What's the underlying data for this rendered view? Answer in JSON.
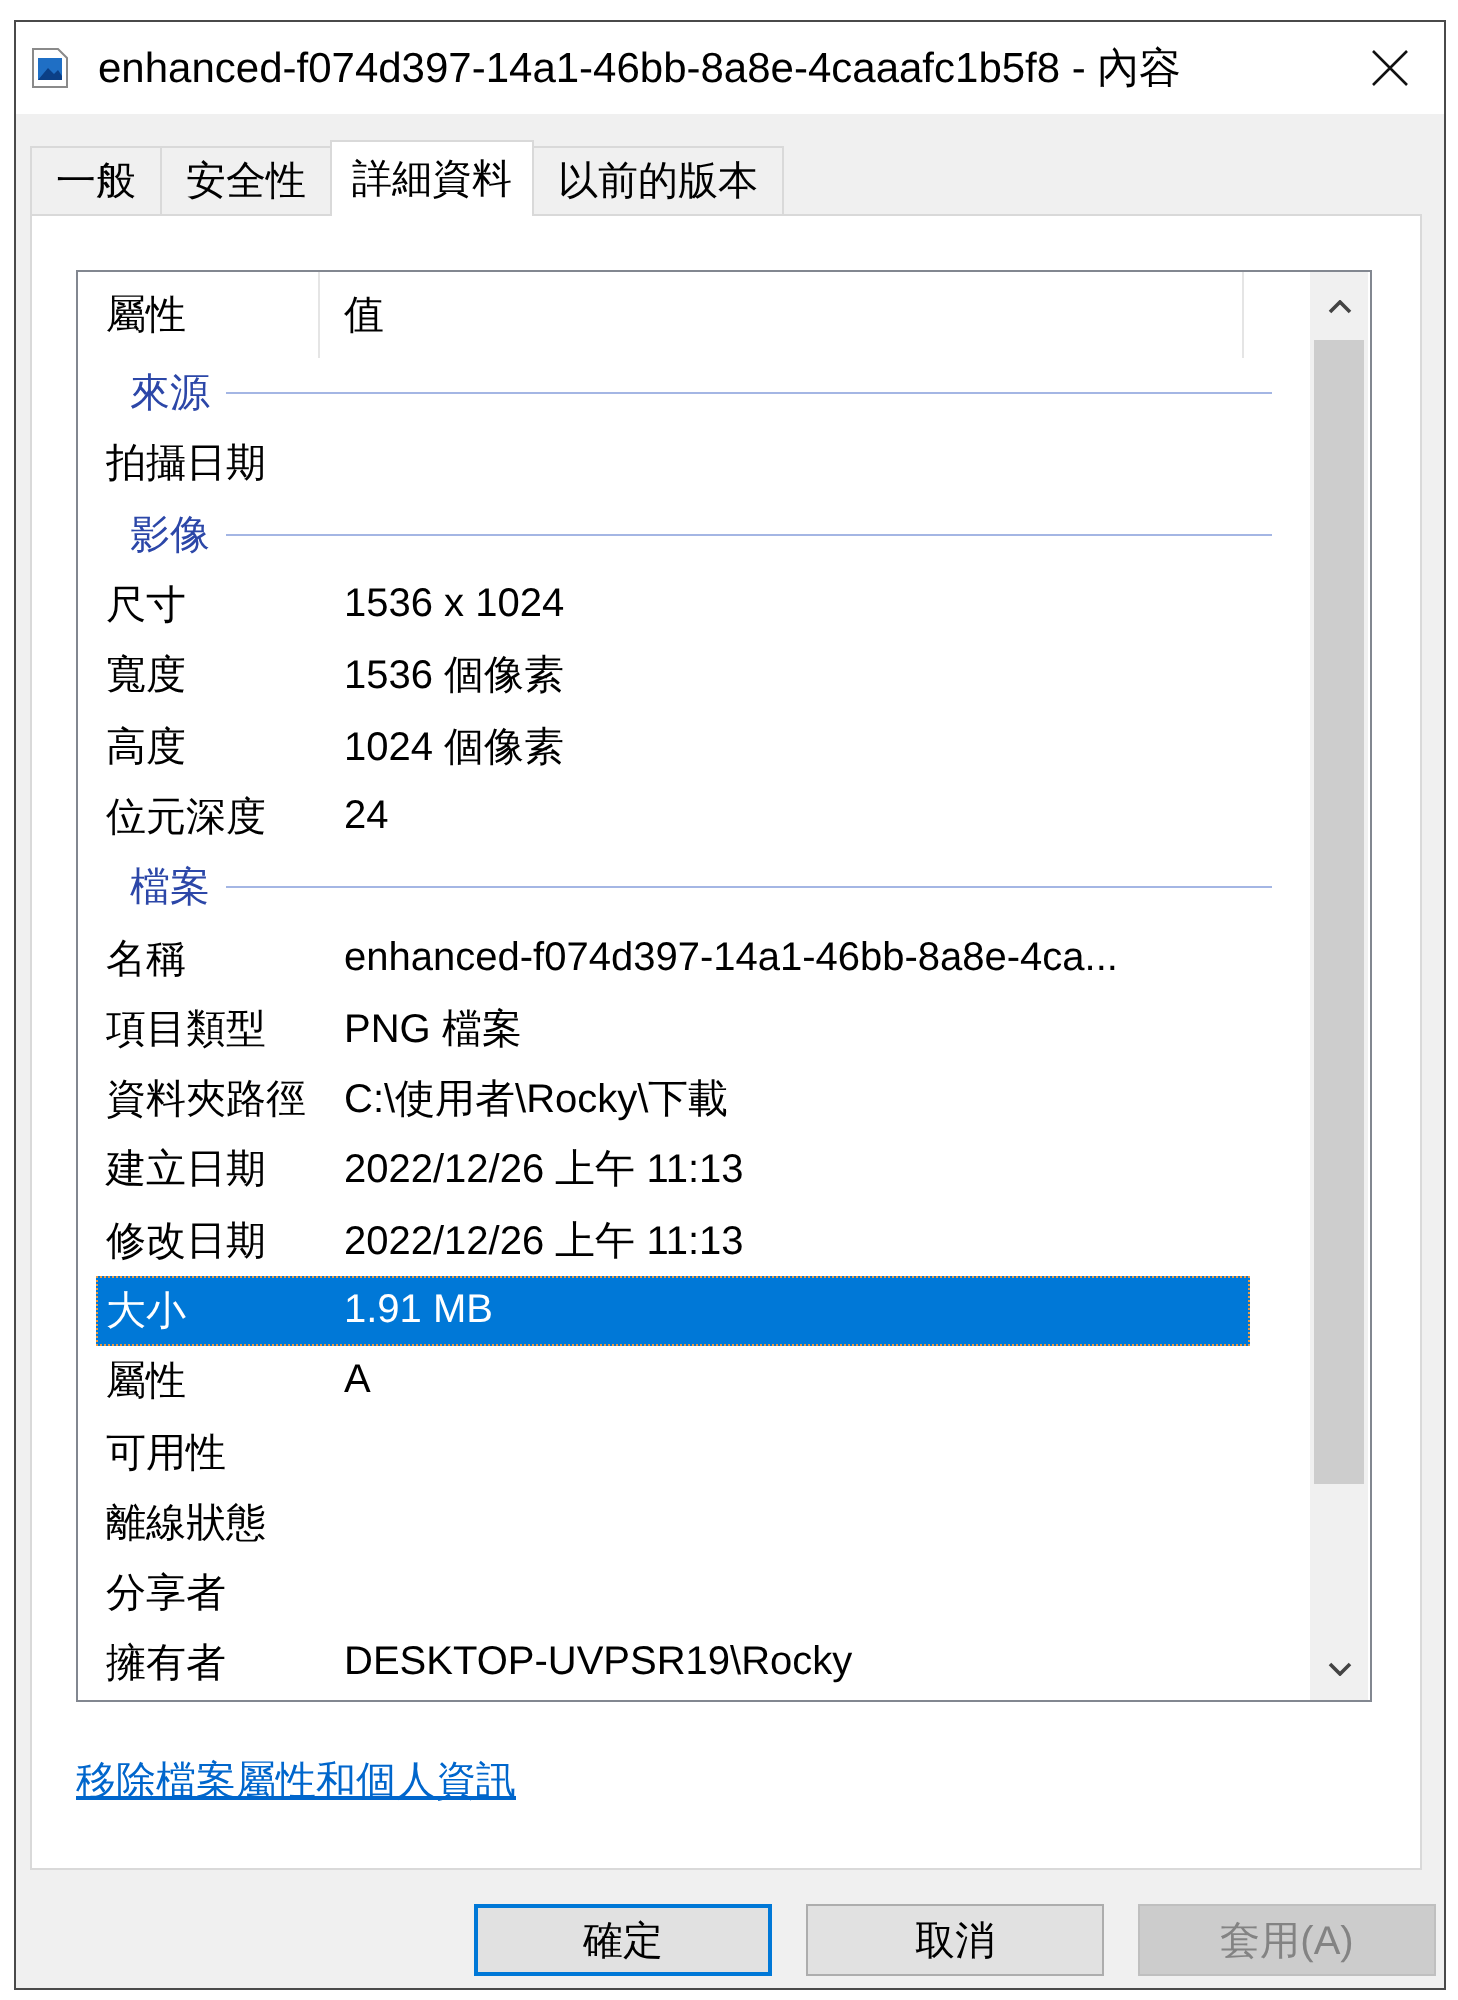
{
  "window": {
    "title": "enhanced-f074d397-14a1-46bb-8a8e-4caaafc1b5f8 - 內容"
  },
  "tabs": [
    {
      "label": "一般",
      "selected": false
    },
    {
      "label": "安全性",
      "selected": false
    },
    {
      "label": "詳細資料",
      "selected": true
    },
    {
      "label": "以前的版本",
      "selected": false
    }
  ],
  "details": {
    "columns": [
      "屬性",
      "值"
    ],
    "groups": [
      {
        "label": "來源",
        "rows": [
          {
            "property": "拍攝日期",
            "selected": false
          }
        ]
      },
      {
        "label": "影像",
        "rows": [
          {
            "property": "尺寸",
            "value": "1536 x 1024",
            "selected": false
          },
          {
            "property": "寬度",
            "value": "1536 個像素",
            "selected": false
          },
          {
            "property": "高度",
            "value": "1024 個像素",
            "selected": false
          },
          {
            "property": "位元深度",
            "value": "24",
            "selected": false
          }
        ]
      },
      {
        "label": "檔案",
        "rows": [
          {
            "property": "名稱",
            "value": "enhanced-f074d397-14a1-46bb-8a8e-4ca...",
            "selected": false
          },
          {
            "property": "項目類型",
            "value": "PNG 檔案",
            "selected": false
          },
          {
            "property": "資料夾路徑",
            "value": "C:\\使用者\\Rocky\\下載",
            "selected": false
          },
          {
            "property": "建立日期",
            "value": "2022/12/26 上午 11:13",
            "selected": false
          },
          {
            "property": "修改日期",
            "value": "2022/12/26 上午 11:13",
            "selected": false
          },
          {
            "property": "大小",
            "value": "1.91 MB",
            "selected": true
          },
          {
            "property": "屬性",
            "value": "A",
            "selected": false
          },
          {
            "property": "可用性",
            "selected": false
          },
          {
            "property": "離線狀態",
            "selected": false
          },
          {
            "property": "分享者",
            "selected": false
          },
          {
            "property": "擁有者",
            "value": "DESKTOP-UVPSR19\\Rocky",
            "selected": false
          }
        ]
      }
    ]
  },
  "link": "移除檔案屬性和個人資訊",
  "buttons": [
    {
      "label": "確定",
      "default": true,
      "disabled": false
    },
    {
      "label": "取消",
      "default": false,
      "disabled": false
    },
    {
      "label": "套用(A)",
      "default": false,
      "disabled": true
    }
  ]
}
